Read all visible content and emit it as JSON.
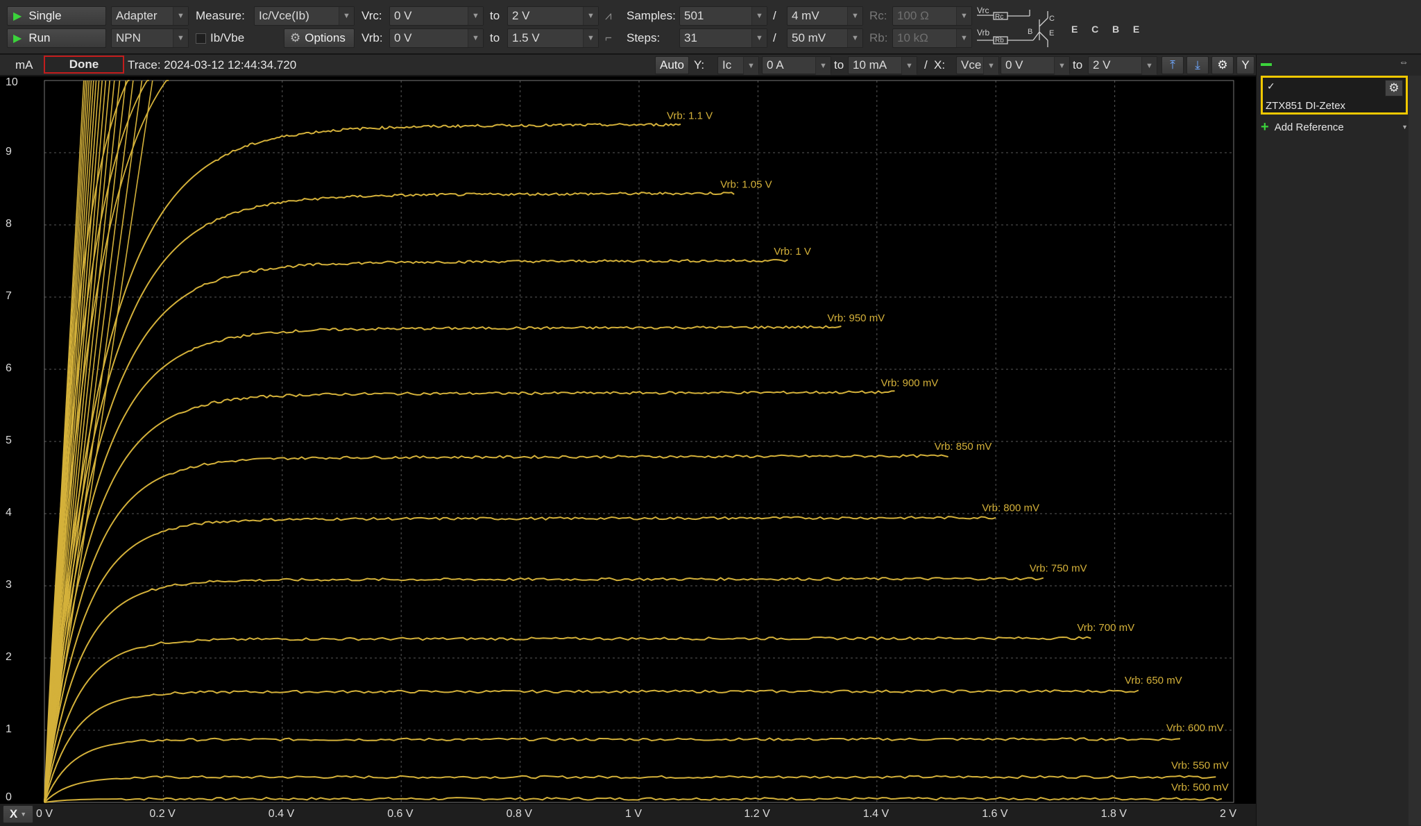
{
  "toolbar": {
    "single_label": "Single",
    "run_label": "Run",
    "adapter_value": "Adapter",
    "npn_value": "NPN",
    "measure_label": "Measure:",
    "measure_value": "Ic/Vce(Ib)",
    "ib_vbe_label": "Ib/Vbe",
    "options_label": "Options",
    "vrc_label": "Vrc:",
    "vrc_from": "0 V",
    "vrc_to_label": "to",
    "vrc_to": "2 V",
    "vrb_label": "Vrb:",
    "vrb_from": "0 V",
    "vrb_to_label": "to",
    "vrb_to": "1.5 V",
    "samples_label": "Samples:",
    "samples_value": "501",
    "samples_sep": "/",
    "samples_step": "4 mV",
    "steps_label": "Steps:",
    "steps_value": "31",
    "steps_sep": "/",
    "steps_step": "50 mV",
    "rc_label": "Rc:",
    "rc_value": "100 Ω",
    "rb_label": "Rb:",
    "rb_value": "10 kΩ",
    "schem_vrc": "Vrc",
    "schem_vrb": "Vrb",
    "schem_rc": "Rc",
    "schem_rb": "Rb",
    "schem_c": "C",
    "schem_b": "B",
    "schem_e": "E",
    "pins": "E  C  B  E"
  },
  "plot_header": {
    "y_unit": "mA",
    "status": "Done",
    "trace": "Trace: 2024-03-12 12:44:34.720",
    "auto_label": "Auto",
    "y_label": "Y:",
    "y_channel": "Ic",
    "y_from": "0 A",
    "y_to_label": "to",
    "y_to": "10 mA",
    "sep": "/",
    "x_label": "X:",
    "x_channel": "Vce",
    "x_from": "0 V",
    "x_to_label": "to",
    "x_to": "2 V",
    "y_button": "Y",
    "x_button": "X"
  },
  "panel": {
    "check": "✓",
    "reference_name": "ZTX851 DI-Zetex",
    "add_reference": "Add Reference"
  },
  "colors": {
    "trace": "#d4b13a",
    "grid": "#5a5a5a",
    "accent": "#f0c800",
    "status_border": "#c21d1d"
  },
  "chart_data": {
    "type": "line",
    "xlabel": "",
    "ylabel": "mA",
    "xlim": [
      0,
      2
    ],
    "ylim": [
      0,
      10
    ],
    "x_ticks": [
      "0 V",
      "0.2 V",
      "0.4 V",
      "0.6 V",
      "0.8 V",
      "1 V",
      "1.2 V",
      "1.4 V",
      "1.6 V",
      "1.8 V",
      "2 V"
    ],
    "y_ticks": [
      "0",
      "1",
      "2",
      "3",
      "4",
      "5",
      "6",
      "7",
      "8",
      "9",
      "10"
    ],
    "grid": true,
    "series": [
      {
        "name": "Vrb: 500 mV",
        "plateau": 0.05,
        "x_end": 1.98
      },
      {
        "name": "Vrb: 550 mV",
        "plateau": 0.35,
        "x_end": 1.97
      },
      {
        "name": "Vrb: 600 mV",
        "plateau": 0.87,
        "x_end": 1.91
      },
      {
        "name": "Vrb: 650 mV",
        "plateau": 1.53,
        "x_end": 1.84
      },
      {
        "name": "Vrb: 700 mV",
        "plateau": 2.26,
        "x_end": 1.76
      },
      {
        "name": "Vrb: 750 mV",
        "plateau": 3.08,
        "x_end": 1.68
      },
      {
        "name": "Vrb: 800 mV",
        "plateau": 3.92,
        "x_end": 1.6
      },
      {
        "name": "Vrb: 850 mV",
        "plateau": 4.77,
        "x_end": 1.52
      },
      {
        "name": "Vrb: 900 mV",
        "plateau": 5.65,
        "x_end": 1.43
      },
      {
        "name": "Vrb: 950 mV",
        "plateau": 6.55,
        "x_end": 1.34
      },
      {
        "name": "Vrb: 1 V",
        "plateau": 7.47,
        "x_end": 1.25
      },
      {
        "name": "Vrb: 1.05 V",
        "plateau": 8.4,
        "x_end": 1.16
      },
      {
        "name": "Vrb: 1.1 V",
        "plateau": 9.35,
        "x_end": 1.07
      }
    ],
    "steep_series_count": 17
  }
}
